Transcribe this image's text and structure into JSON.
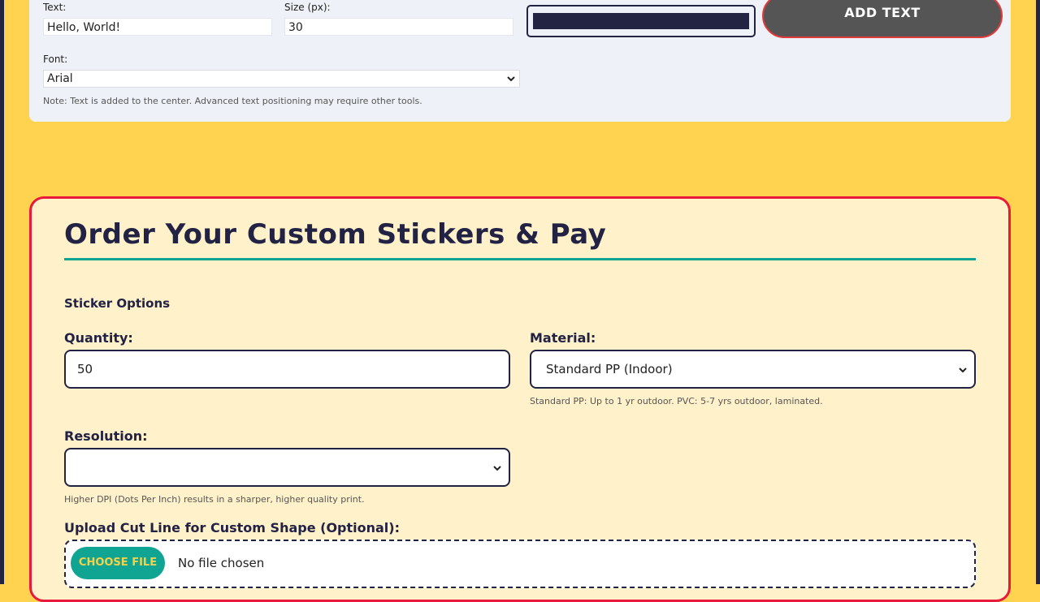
{
  "text_tool": {
    "text_label": "Text:",
    "text_value": "Hello, World!",
    "size_label": "Size (px):",
    "size_value": "30",
    "font_label": "Font:",
    "font_value": "Arial",
    "note": "Note: Text is added to the center. Advanced text positioning may require other tools.",
    "color_value": "#232344",
    "add_button": "ADD TEXT"
  },
  "order": {
    "title": "Order Your Custom Stickers & Pay",
    "section": "Sticker Options",
    "quantity_label": "Quantity:",
    "quantity_value": "50",
    "material_label": "Material:",
    "material_value": "Standard PP (Indoor)",
    "material_hint": "Standard PP: Up to 1 yr outdoor. PVC: 5-7 yrs outdoor, laminated.",
    "resolution_label": "Resolution:",
    "resolution_value": "",
    "resolution_hint": "Higher DPI (Dots Per Inch) results in a sharper, higher quality print.",
    "upload_label": "Upload Cut Line for Custom Shape (Optional):",
    "choose_button": "CHOOSE FILE",
    "no_file": "No file chosen"
  },
  "colors": {
    "background": "#ffd350",
    "accent_teal": "#10a592",
    "accent_red": "#e8193b",
    "navy": "#222244"
  }
}
